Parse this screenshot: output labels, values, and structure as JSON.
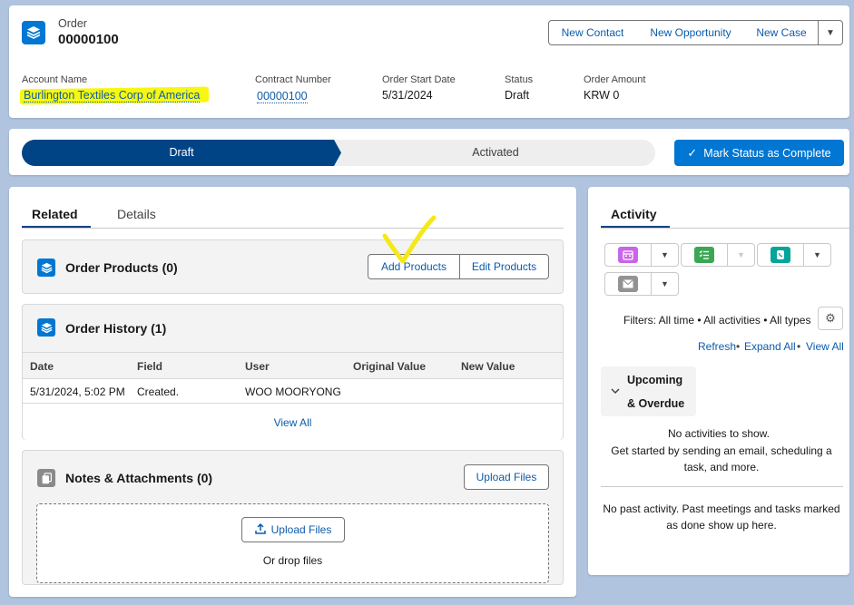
{
  "header": {
    "object_label": "Order",
    "record_number": "00000100",
    "actions": {
      "new_contact": "New Contact",
      "new_opportunity": "New Opportunity",
      "new_case": "New Case"
    },
    "fields": [
      {
        "label": "Account Name",
        "value": "Burlington Textiles Corp of America"
      },
      {
        "label": "Contract Number",
        "value": "00000100"
      },
      {
        "label": "Order Start Date",
        "value": "5/31/2024"
      },
      {
        "label": "Status",
        "value": "Draft"
      },
      {
        "label": "Order Amount",
        "value": "KRW 0"
      }
    ]
  },
  "path": {
    "steps": [
      "Draft",
      "Activated"
    ],
    "current_index": 0,
    "mark_complete_label": "Mark Status as Complete"
  },
  "tabs": [
    "Related",
    "Details"
  ],
  "order_products": {
    "title": "Order Products (0)",
    "add_label": "Add Products",
    "edit_label": "Edit Products"
  },
  "order_history": {
    "title": "Order History (1)",
    "columns": [
      "Date",
      "Field",
      "User",
      "Original Value",
      "New Value"
    ],
    "rows": [
      {
        "date": "5/31/2024, 5:02 PM",
        "field": "Created.",
        "user": "WOO MOORYONG",
        "original": "",
        "new": ""
      }
    ],
    "view_all": "View All"
  },
  "notes": {
    "title": "Notes & Attachments (0)",
    "upload_label": "Upload Files",
    "drop_upload_label": "Upload Files",
    "drop_text": "Or drop files"
  },
  "activity": {
    "tab": "Activity",
    "filters": "Filters: All time • All activities • All types",
    "refresh": "Refresh",
    "expand_all": "Expand All",
    "view_all": "View All",
    "upcoming_line1": "Upcoming",
    "upcoming_line2": "& Overdue",
    "no_activities": "No activities to show.",
    "get_started": "Get started by sending an email, scheduling a task, and more.",
    "no_past": "No past activity. Past meetings and tasks marked as done show up here."
  },
  "colors": {
    "brand": "#0176d3",
    "path_active": "#014486",
    "link": "#0b5cab",
    "highlight": "#f7f711"
  }
}
